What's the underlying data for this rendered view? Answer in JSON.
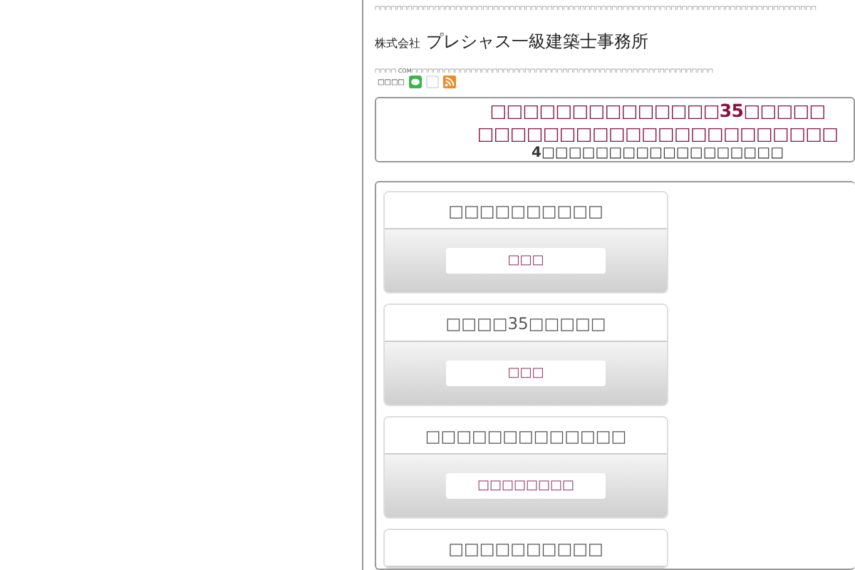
{
  "top_notice": "□□□□□□□□□□□□□□□□□□□□□□□□□□□□□□□□□□□□□□□□□□□□□□□□□□□□□□□□□□□□□□□□□□□□□□□□□□□□□□□□□□",
  "logo": {
    "prefix": "株式会社",
    "name": "プレシャス一級建築士事務所"
  },
  "tagline": "□□□□ COM□□□□□□□□□□□□□□□□□□□□□□□□□□□□□□□□□□□□□□□□□□□□□□□□□□□□□□□□",
  "share": {
    "label": "□□□□"
  },
  "headline": {
    "lines": [
      "□□□□□□□□□□□□□□35□□□□□",
      "□□□□□□□□□□□□□□□□□□□□□□"
    ],
    "sub": "4□□□□□□□□□□□□□□□□□□"
  },
  "cards": [
    {
      "title": "□□□□□□□□□□",
      "button": "□□□"
    },
    {
      "title": "□□□□35□□□□□",
      "button": "□□□"
    },
    {
      "title": "□□□□□□□□□□□□□",
      "button": "□□□□□□□□"
    },
    {
      "title": "□□□□□□□□□□"
    }
  ]
}
